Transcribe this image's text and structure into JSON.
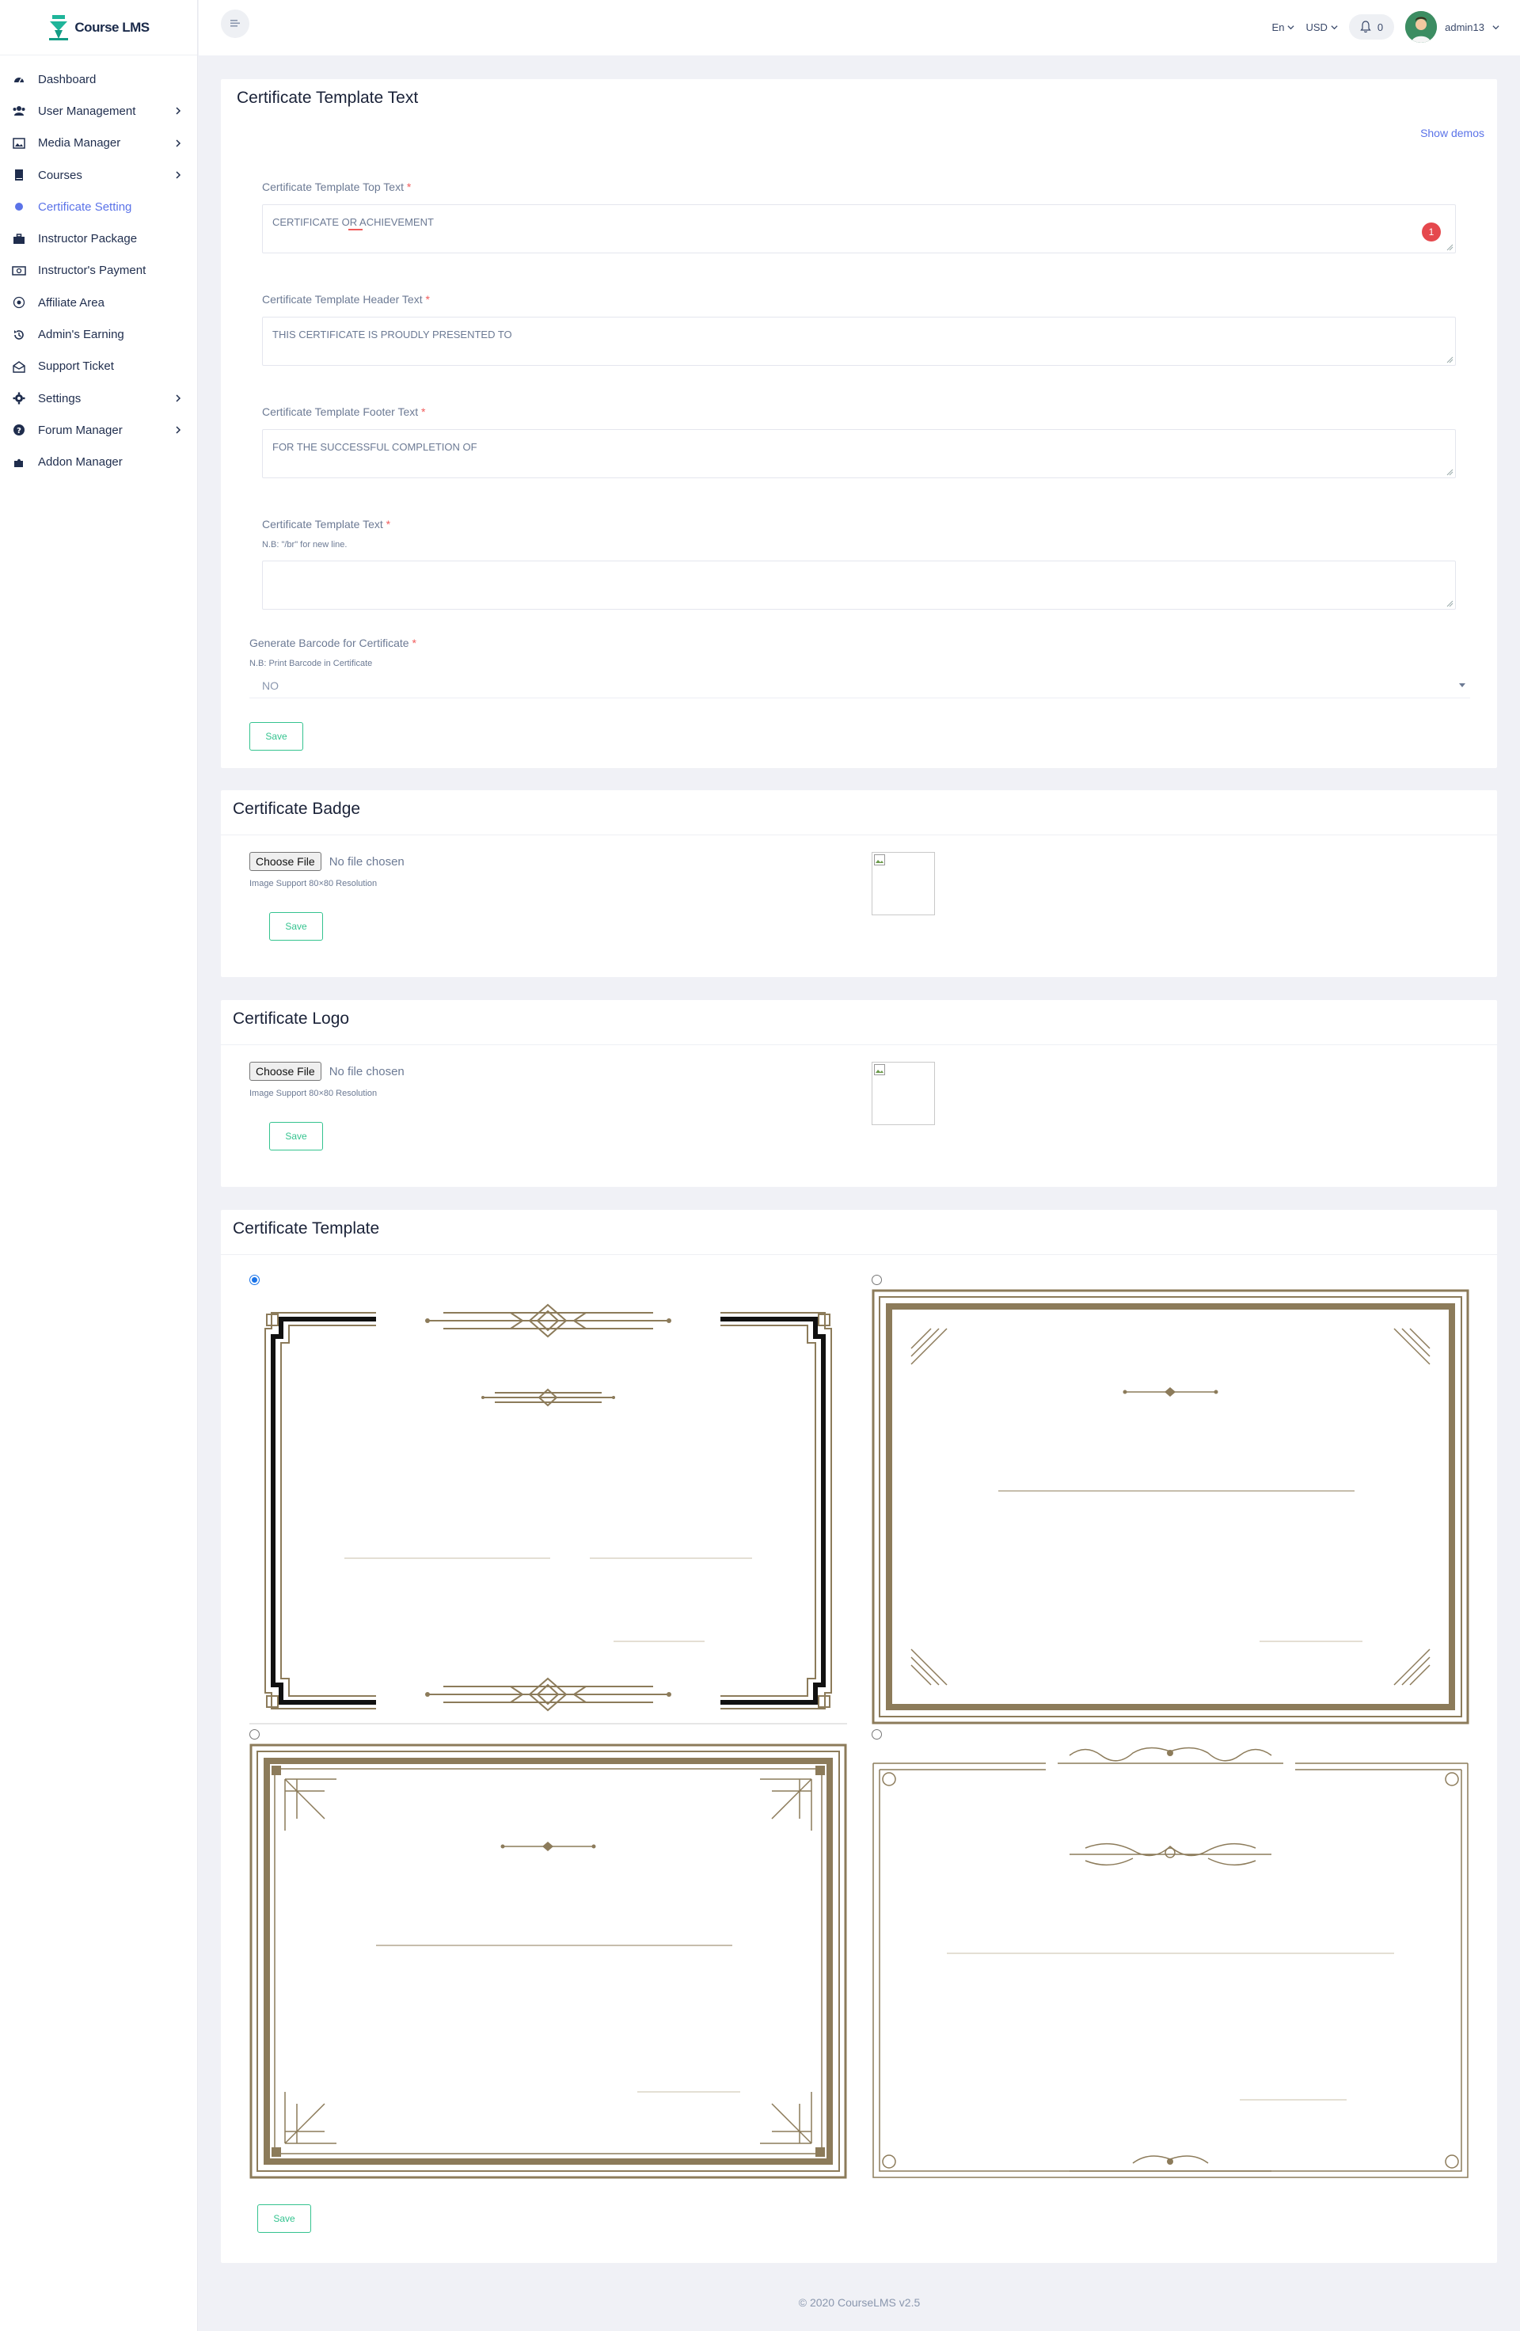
{
  "brand": {
    "name": "Course LMS"
  },
  "sidebar": {
    "items": [
      {
        "label": "Dashboard",
        "icon": "dashboard-icon",
        "chevron": false
      },
      {
        "label": "User Management",
        "icon": "users-icon",
        "chevron": true
      },
      {
        "label": "Media Manager",
        "icon": "image-icon",
        "chevron": true
      },
      {
        "label": "Courses",
        "icon": "book-icon",
        "chevron": true
      },
      {
        "label": "Certificate Setting",
        "icon": "dot-icon",
        "chevron": false,
        "active": true
      },
      {
        "label": "Instructor Package",
        "icon": "briefcase-icon",
        "chevron": false
      },
      {
        "label": "Instructor's Payment",
        "icon": "money-icon",
        "chevron": false
      },
      {
        "label": "Affiliate Area",
        "icon": "target-icon",
        "chevron": false
      },
      {
        "label": "Admin's Earning",
        "icon": "history-icon",
        "chevron": false
      },
      {
        "label": "Support Ticket",
        "icon": "envelope-open-icon",
        "chevron": false
      },
      {
        "label": "Settings",
        "icon": "gear-icon",
        "chevron": true
      },
      {
        "label": "Forum Manager",
        "icon": "question-icon",
        "chevron": true
      },
      {
        "label": "Addon Manager",
        "icon": "puzzle-icon",
        "chevron": false
      }
    ]
  },
  "header": {
    "language": "En",
    "currency": "USD",
    "notifications": "0",
    "username": "admin13"
  },
  "template_text": {
    "title": "Certificate Template Text",
    "show_demos": "Show demos",
    "top_label": "Certificate Template Top Text",
    "top_value": "CERTIFICATE OR ACHIEVEMENT",
    "top_badge": "1",
    "header_label": "Certificate Template Header Text",
    "header_value": "THIS CERTIFICATE IS PROUDLY PRESENTED TO",
    "footer_label": "Certificate Template Footer Text",
    "footer_value": "FOR THE SUCCESSFUL COMPLETION OF",
    "text_label": "Certificate Template Text",
    "text_note": "N.B: \"/br\" for new line.",
    "text_value": "",
    "barcode_label": "Generate Barcode for Certificate",
    "barcode_note": "N.B: Print Barcode in Certificate",
    "barcode_value": "NO",
    "save_label": "Save"
  },
  "badge": {
    "title": "Certificate Badge",
    "choose_label": "Choose File",
    "no_file": "No file chosen",
    "note": "Image Support 80×80 Resolution",
    "save_label": "Save"
  },
  "logo": {
    "title": "Certificate Logo",
    "choose_label": "Choose File",
    "no_file": "No file chosen",
    "note": "Image Support 80×80 Resolution",
    "save_label": "Save"
  },
  "templates": {
    "title": "Certificate Template",
    "selected_index": 0,
    "save_label": "Save"
  },
  "footer": {
    "text": "© 2020 CourseLMS v2.5"
  },
  "colors": {
    "accent": "#5b73e8",
    "success": "#34c38f",
    "danger": "#f46a6a",
    "frame": "#8c7b5a",
    "frame_dark": "#111111"
  }
}
